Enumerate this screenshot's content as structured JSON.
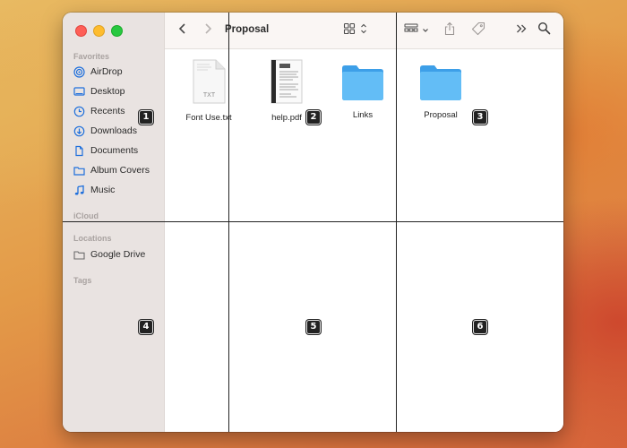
{
  "window": {
    "title": "Proposal"
  },
  "sidebar": {
    "favorites_title": "Favorites",
    "items": [
      {
        "label": "AirDrop",
        "icon": "airdrop-icon"
      },
      {
        "label": "Desktop",
        "icon": "desktop-icon"
      },
      {
        "label": "Recents",
        "icon": "clock-icon"
      },
      {
        "label": "Downloads",
        "icon": "download-icon"
      },
      {
        "label": "Documents",
        "icon": "document-icon"
      },
      {
        "label": "Album Covers",
        "icon": "folder-icon"
      },
      {
        "label": "Music",
        "icon": "music-note-icon"
      }
    ],
    "icloud_title": "iCloud",
    "locations_title": "Locations",
    "locations": [
      {
        "label": "Google Drive",
        "icon": "drive-folder-icon"
      }
    ],
    "tags_title": "Tags"
  },
  "files": [
    {
      "name": "Font Use.txt",
      "kind": "txt",
      "badge_text": "TXT"
    },
    {
      "name": "help.pdf",
      "kind": "pdf"
    },
    {
      "name": "Links",
      "kind": "folder"
    },
    {
      "name": "Proposal",
      "kind": "folder"
    }
  ],
  "grid_labels": [
    "1",
    "2",
    "3",
    "4",
    "5",
    "6"
  ],
  "colors": {
    "accent": "#1e6fdc",
    "folder": "#5ab9f5",
    "sidebar_bg": "#e9e3e1"
  }
}
